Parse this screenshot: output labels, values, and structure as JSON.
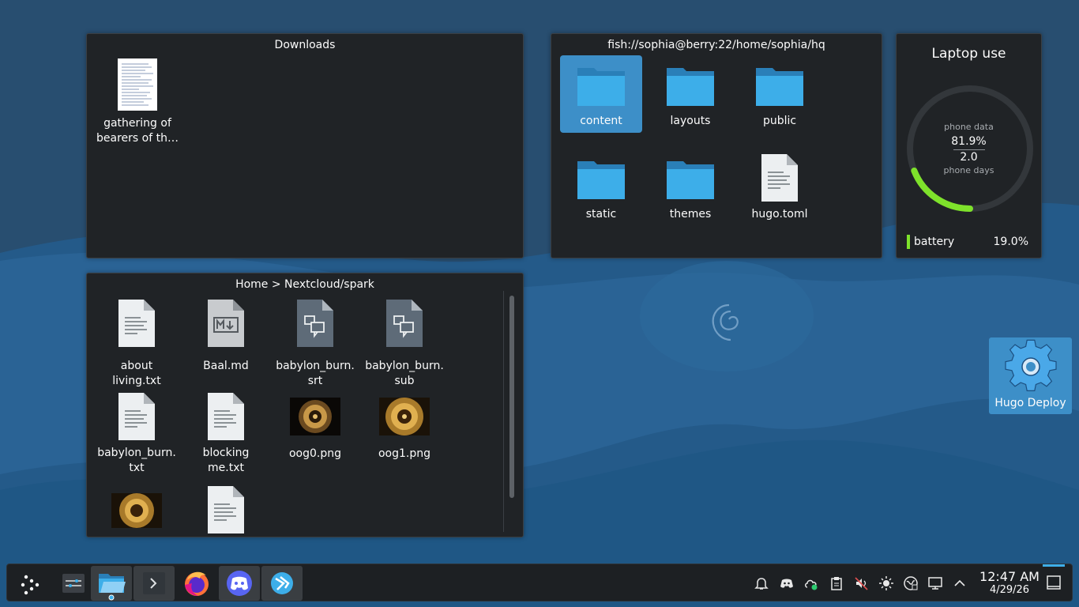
{
  "downloads": {
    "title": "Downloads",
    "items": [
      {
        "label": "gathering of bearers of th…",
        "icon": "document-thumbnail-icon"
      }
    ]
  },
  "hq": {
    "title": "fish://sophia@berry:22/home/sophia/hq",
    "items": [
      {
        "label": "content",
        "icon": "folder-icon",
        "selected": true
      },
      {
        "label": "layouts",
        "icon": "folder-icon"
      },
      {
        "label": "public",
        "icon": "folder-icon"
      },
      {
        "label": "static",
        "icon": "folder-icon"
      },
      {
        "label": "themes",
        "icon": "folder-icon"
      },
      {
        "label": "hugo.toml",
        "icon": "text-file-icon"
      }
    ]
  },
  "spark": {
    "title": "Home > Nextcloud/spark",
    "items": [
      {
        "label": "about living.txt",
        "icon": "text-file-icon"
      },
      {
        "label": "Baal.md",
        "icon": "markdown-file-icon"
      },
      {
        "label": "babylon_burn.\nsrt",
        "icon": "subtitle-file-icon"
      },
      {
        "label": "babylon_burn.\nsub",
        "icon": "subtitle-file-icon"
      },
      {
        "label": "babylon_burn.\ntxt",
        "icon": "text-file-icon"
      },
      {
        "label": "blocking me.txt",
        "icon": "text-file-icon"
      },
      {
        "label": "oog0.png",
        "icon": "image-thumbnail-icon"
      },
      {
        "label": "oog1.png",
        "icon": "image-thumbnail-icon"
      }
    ]
  },
  "laptop": {
    "title": "Laptop use",
    "inner_label_top": "phone data",
    "inner_value_top": "81.9%",
    "inner_value_bottom": "2.0",
    "inner_label_bottom": "phone days",
    "battery_label": "battery",
    "battery_value": "19.0%",
    "ring_fraction": 0.19,
    "ring_color": "#7ee22b"
  },
  "desktop": {
    "hugo_deploy_label": "Hugo Deploy"
  },
  "taskbar": {
    "clock_time": "12:47 AM",
    "clock_date": "4/29/26",
    "apps": [
      "app-launcher-icon",
      "pager-icon",
      "file-manager-icon",
      "terminal-icon",
      "firefox-icon",
      "discord-icon",
      "kdeconnect-icon"
    ],
    "tray": [
      "notifications-icon",
      "discord-tray-icon",
      "cloud-sync-icon",
      "clipboard-icon",
      "volume-muted-icon",
      "brightness-icon",
      "network-icon",
      "display-icon",
      "expand-tray-icon"
    ]
  },
  "colors": {
    "accent": "#3d8fc8",
    "folder": "#3daee9",
    "panel_bg": "#202326"
  }
}
